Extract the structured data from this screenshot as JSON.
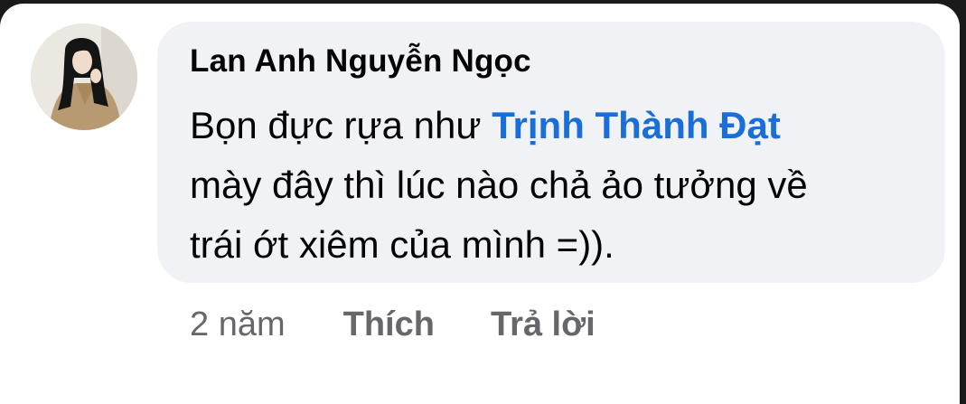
{
  "comment": {
    "author": "Lan Anh Nguyễn Ngọc",
    "text_lines": [
      {
        "before": "Bọn đực rựa như ",
        "mention": "Trịnh Thành Đạt"
      },
      {
        "text": "mày đây thì lúc nào chả ảo tưởng về"
      },
      {
        "text": "trái ớt xiêm của mình =))."
      }
    ],
    "time": "2 năm",
    "like_label": "Thích",
    "reply_label": "Trả lời"
  },
  "colors": {
    "bubble": "#f0f2f5",
    "mention": "#1a6ed8",
    "meta": "#65676b",
    "text": "#050505"
  },
  "icons": {
    "avatar": "profile-photo"
  }
}
